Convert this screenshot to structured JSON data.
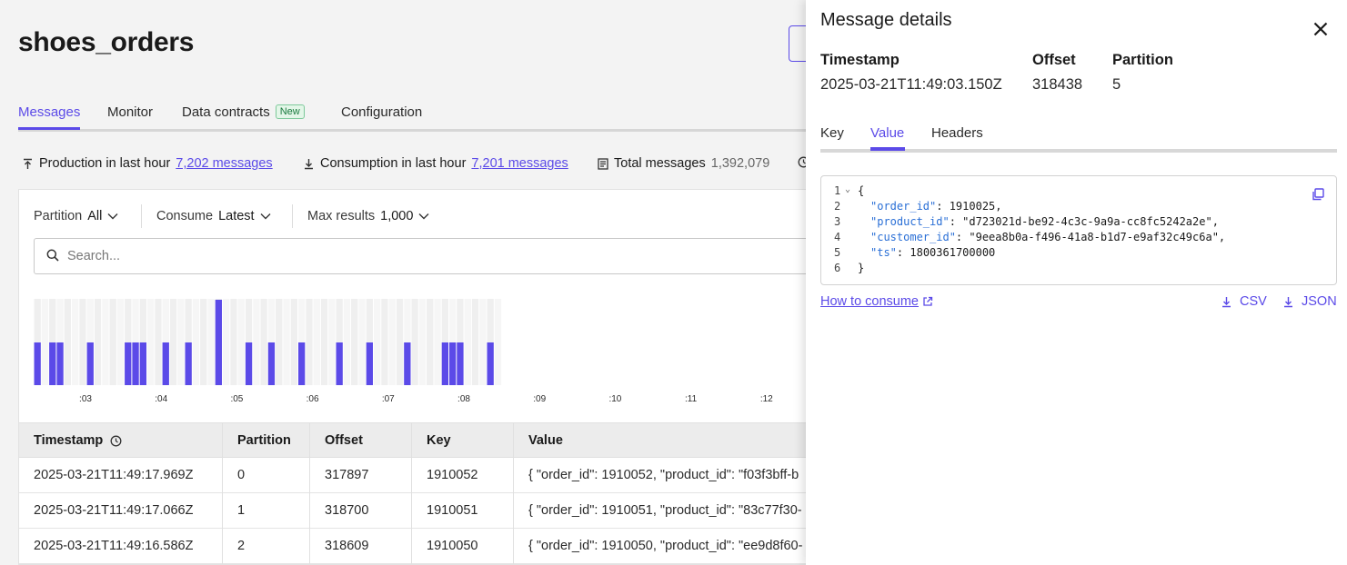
{
  "page": {
    "title": "shoes_orders",
    "tabs": [
      {
        "label": "Messages",
        "active": true
      },
      {
        "label": "Monitor"
      },
      {
        "label": "Data contracts",
        "badge": "New"
      },
      {
        "label": "Configuration"
      }
    ],
    "stats": {
      "production_label": "Production in last hour",
      "production_value": "7,202 messages",
      "consumption_label": "Consumption in last hour",
      "consumption_value": "7,201 messages",
      "total_label": "Total messages",
      "total_value": "1,392,079"
    },
    "filters": {
      "partition_label": "Partition",
      "partition_value": "All",
      "consume_label": "Consume",
      "consume_value": "Latest",
      "max_label": "Max results",
      "max_value": "1,000"
    },
    "search": {
      "placeholder": "Search..."
    },
    "accent_color": "#5b4ae8",
    "histogram": {
      "tick_labels": [
        ":03",
        ":04",
        ":05",
        ":06",
        ":07",
        ":08",
        ":09",
        ":10",
        ":11",
        ":12"
      ],
      "bins": [
        1,
        0,
        1,
        1,
        0,
        0,
        0,
        1,
        0,
        0,
        0,
        0,
        1,
        1,
        1,
        0,
        0,
        1,
        0,
        0,
        1,
        0,
        0,
        0,
        2,
        0,
        0,
        0,
        1,
        0,
        0,
        1,
        0,
        0,
        0,
        1,
        0,
        0,
        0,
        0,
        1,
        0,
        0,
        0,
        1,
        0,
        0,
        0,
        0,
        1,
        0,
        0,
        0,
        0,
        1,
        1,
        1,
        0,
        0,
        0,
        1,
        0
      ]
    },
    "table": {
      "columns": [
        "Timestamp",
        "Partition",
        "Offset",
        "Key",
        "Value"
      ],
      "rows": [
        [
          "2025-03-21T11:49:17.969Z",
          "0",
          "317897",
          "1910052",
          "{ \"order_id\": 1910052, \"product_id\": \"f03f3bff-b"
        ],
        [
          "2025-03-21T11:49:17.066Z",
          "1",
          "318700",
          "1910051",
          "{ \"order_id\": 1910051, \"product_id\": \"83c77f30-"
        ],
        [
          "2025-03-21T11:49:16.586Z",
          "2",
          "318609",
          "1910050",
          "{ \"order_id\": 1910050, \"product_id\": \"ee9d8f60-"
        ]
      ]
    }
  },
  "drawer": {
    "title": "Message details",
    "timestamp_label": "Timestamp",
    "timestamp_value": "2025-03-21T11:49:03.150Z",
    "offset_label": "Offset",
    "offset_value": "318438",
    "partition_label": "Partition",
    "partition_value": "5",
    "tabs": [
      {
        "label": "Key"
      },
      {
        "label": "Value",
        "active": true
      },
      {
        "label": "Headers"
      }
    ],
    "code": {
      "line_numbers": [
        "1",
        "2",
        "3",
        "4",
        "5",
        "6"
      ],
      "open_brace": "{",
      "close_brace": "}",
      "fields": [
        {
          "key": "\"order_id\"",
          "value": " 1910025,"
        },
        {
          "key": "\"product_id\"",
          "value": " \"d723021d-be92-4c3c-9a9a-cc8fc5242a2e\","
        },
        {
          "key": "\"customer_id\"",
          "value": " \"9eea8b0a-f496-41a8-b1d7-e9af32c49c6a\","
        },
        {
          "key": "\"ts\"",
          "value": " 1800361700000"
        }
      ]
    },
    "how_to_consume": "How to consume",
    "download_csv": "CSV",
    "download_json": "JSON"
  }
}
